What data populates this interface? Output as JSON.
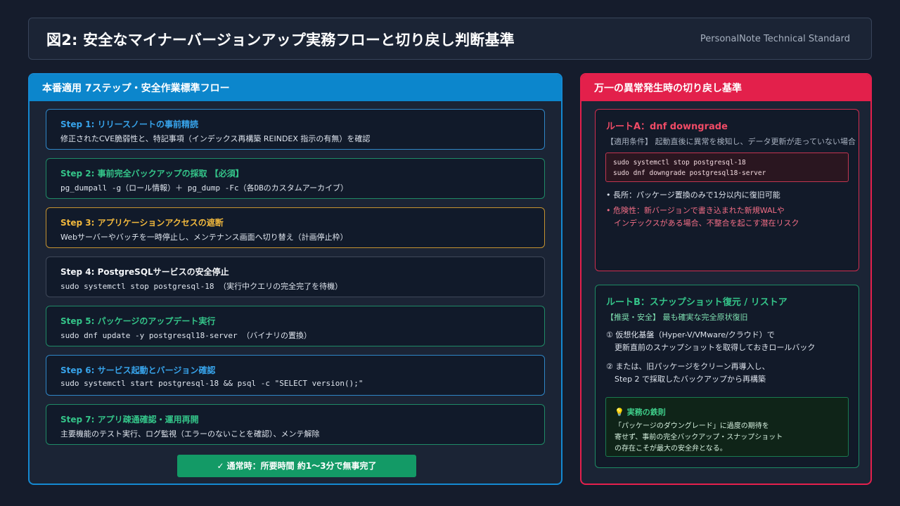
{
  "header": {
    "title": "図2: 安全なマイナーバージョンアップ実務フローと切り戻し判断基準",
    "brand": "PersonalNote Technical Standard"
  },
  "left_panel": {
    "title": "本番適用 7ステップ・安全作業標準フロー",
    "steps": [
      {
        "title": "Step 1: リリースノートの事前精読",
        "desc": "修正されたCVE脆弱性と、特記事項（インデックス再構築 REINDEX 指示の有無）を確認"
      },
      {
        "title": "Step 2: 事前完全バックアップの採取 【必須】",
        "desc": "pg_dumpall -g（ロール情報）＋ pg_dump -Fc（各DBのカスタムアーカイブ）"
      },
      {
        "title": "Step 3: アプリケーションアクセスの遮断",
        "desc": "Webサーバーやバッチを一時停止し、メンテナンス画面へ切り替え（計画停止枠）"
      },
      {
        "title": "Step 4: PostgreSQLサービスの安全停止",
        "desc": "sudo systemctl stop postgresql-18 （実行中クエリの完全完了を待機）"
      },
      {
        "title": "Step 5: パッケージのアップデート実行",
        "desc": "sudo dnf update -y postgresql18-server （バイナリの置換）"
      },
      {
        "title": "Step 6: サービス起動とバージョン確認",
        "desc": "sudo systemctl start postgresql-18 && psql -c \"SELECT version();\""
      },
      {
        "title": "Step 7: アプリ疎通確認・運用再開",
        "desc": "主要機能のテスト実行、ログ監視（エラーのないことを確認）、メンテ解除"
      }
    ],
    "done_label": "✓ 通常時：所要時間 約1〜3分で無事完了"
  },
  "right_panel": {
    "title": "万一の異常発生時の切り戻し基準",
    "route_a": {
      "title": "ルートA：dnf downgrade",
      "condition": "【適用条件】 起動直後に異常を検知し、データ更新が走っていない場合",
      "code": [
        "sudo systemctl stop postgresql-18",
        "sudo dnf downgrade postgresql18-server"
      ],
      "pro": "• 長所：パッケージ置換のみで1分以内に復旧可能",
      "con_1": "• 危険性：新バージョンで書き込まれた新規WALや",
      "con_2": "インデックスがある場合、不整合を起こす潜在リスク"
    },
    "route_b": {
      "title": "ルートB：スナップショット復元 / リストア",
      "condition": "【推奨・安全】 最も確実な完全原状復旧",
      "item1_1": "① 仮想化基盤（Hyper-V/VMware/クラウド）で",
      "item1_2": "更新直前のスナップショットを取得しておきロールバック",
      "item2_1": "② または、旧パッケージをクリーン再導入し、",
      "item2_2": "Step 2 で採取したバックアップから再構築",
      "tip_title": "実務の鉄則",
      "tip_lines": [
        "「パッケージのダウングレード」に過度の期待を",
        "寄せず、事前の完全バックアップ・スナップショット",
        "の存在こそが最大の安全弁となる。"
      ]
    }
  }
}
